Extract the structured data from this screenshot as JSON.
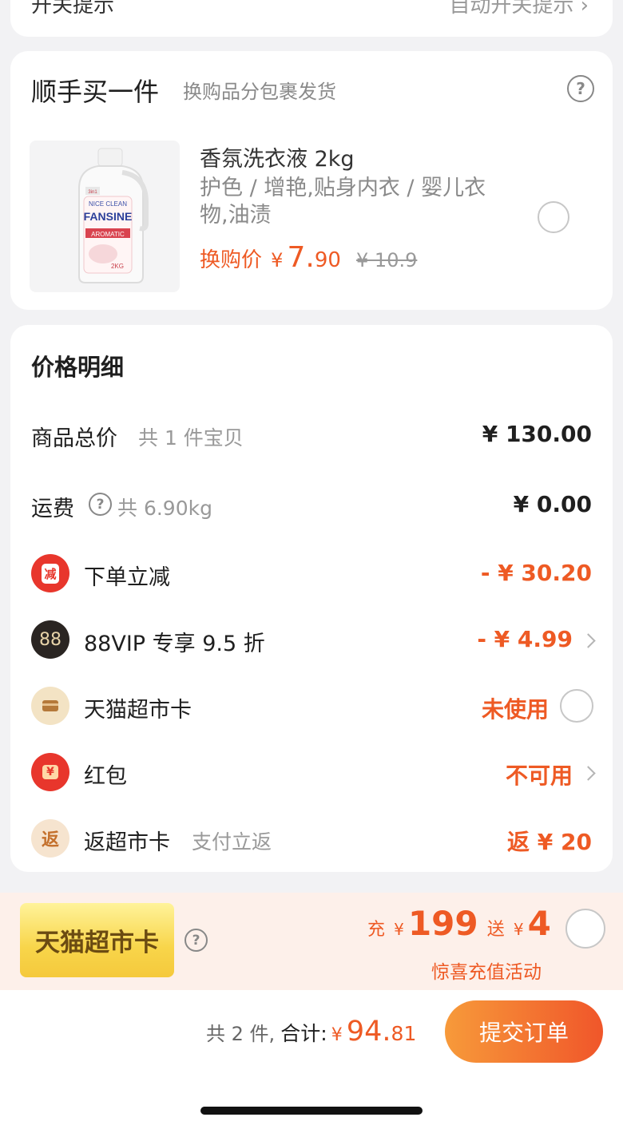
{
  "top_card": {
    "left_text": "开关提示",
    "right_text": "自动开关提示 ›"
  },
  "addon": {
    "title": "顺手买一件",
    "subtitle": "换购品分包裹发货",
    "help_icon": "?",
    "product": {
      "name": "香氛洗衣液 2kg",
      "desc": "护色 / 增艳,贴身内衣 / 婴儿衣物,油渍",
      "price_label": "换购价",
      "currency": "¥",
      "price_int": "7.",
      "price_dec": "90",
      "orig_price": "¥ 10.9",
      "bottle_brand": "FANSINE",
      "bottle_top": "NICE CLEAN",
      "bottle_label": "AROMATIC",
      "bottle_size": "2KG",
      "bottle_badge": "3in1"
    }
  },
  "price_detail": {
    "title": "价格明细",
    "goods": {
      "label": "商品总价",
      "sub": "共 1 件宝贝",
      "value": "¥ 130.00"
    },
    "shipping": {
      "label": "运费",
      "sub": "共 6.90kg",
      "value": "¥ 0.00"
    },
    "instant_discount": {
      "icon": "减",
      "label": "下单立减",
      "value": "- ¥ 30.20"
    },
    "vip": {
      "icon": "88",
      "label": "88VIP 专享 9.5 折",
      "value": "- ¥ 4.99"
    },
    "supermarket_card": {
      "label": "天猫超市卡",
      "value": "未使用"
    },
    "red_packet": {
      "icon": "¥",
      "label": "红包",
      "value": "不可用"
    },
    "cashback": {
      "icon": "返",
      "label": "返超市卡",
      "sub": "支付立返",
      "value": "返 ¥ 20"
    }
  },
  "banner": {
    "card_text": "天猫超市卡",
    "charge_label": "充",
    "charge_currency": "¥",
    "charge_amount": "199",
    "gift_label": "送",
    "gift_currency": "¥",
    "gift_amount": "4",
    "activity": "惊喜充值活动"
  },
  "footer": {
    "count": "共 2 件,",
    "total_label": "合计:",
    "currency": "¥",
    "total_int": "94.",
    "total_dec": "81",
    "submit": "提交订单"
  },
  "colors": {
    "accent": "#ee5a24",
    "red": "#e8362c",
    "gold": "#f5c93c"
  }
}
